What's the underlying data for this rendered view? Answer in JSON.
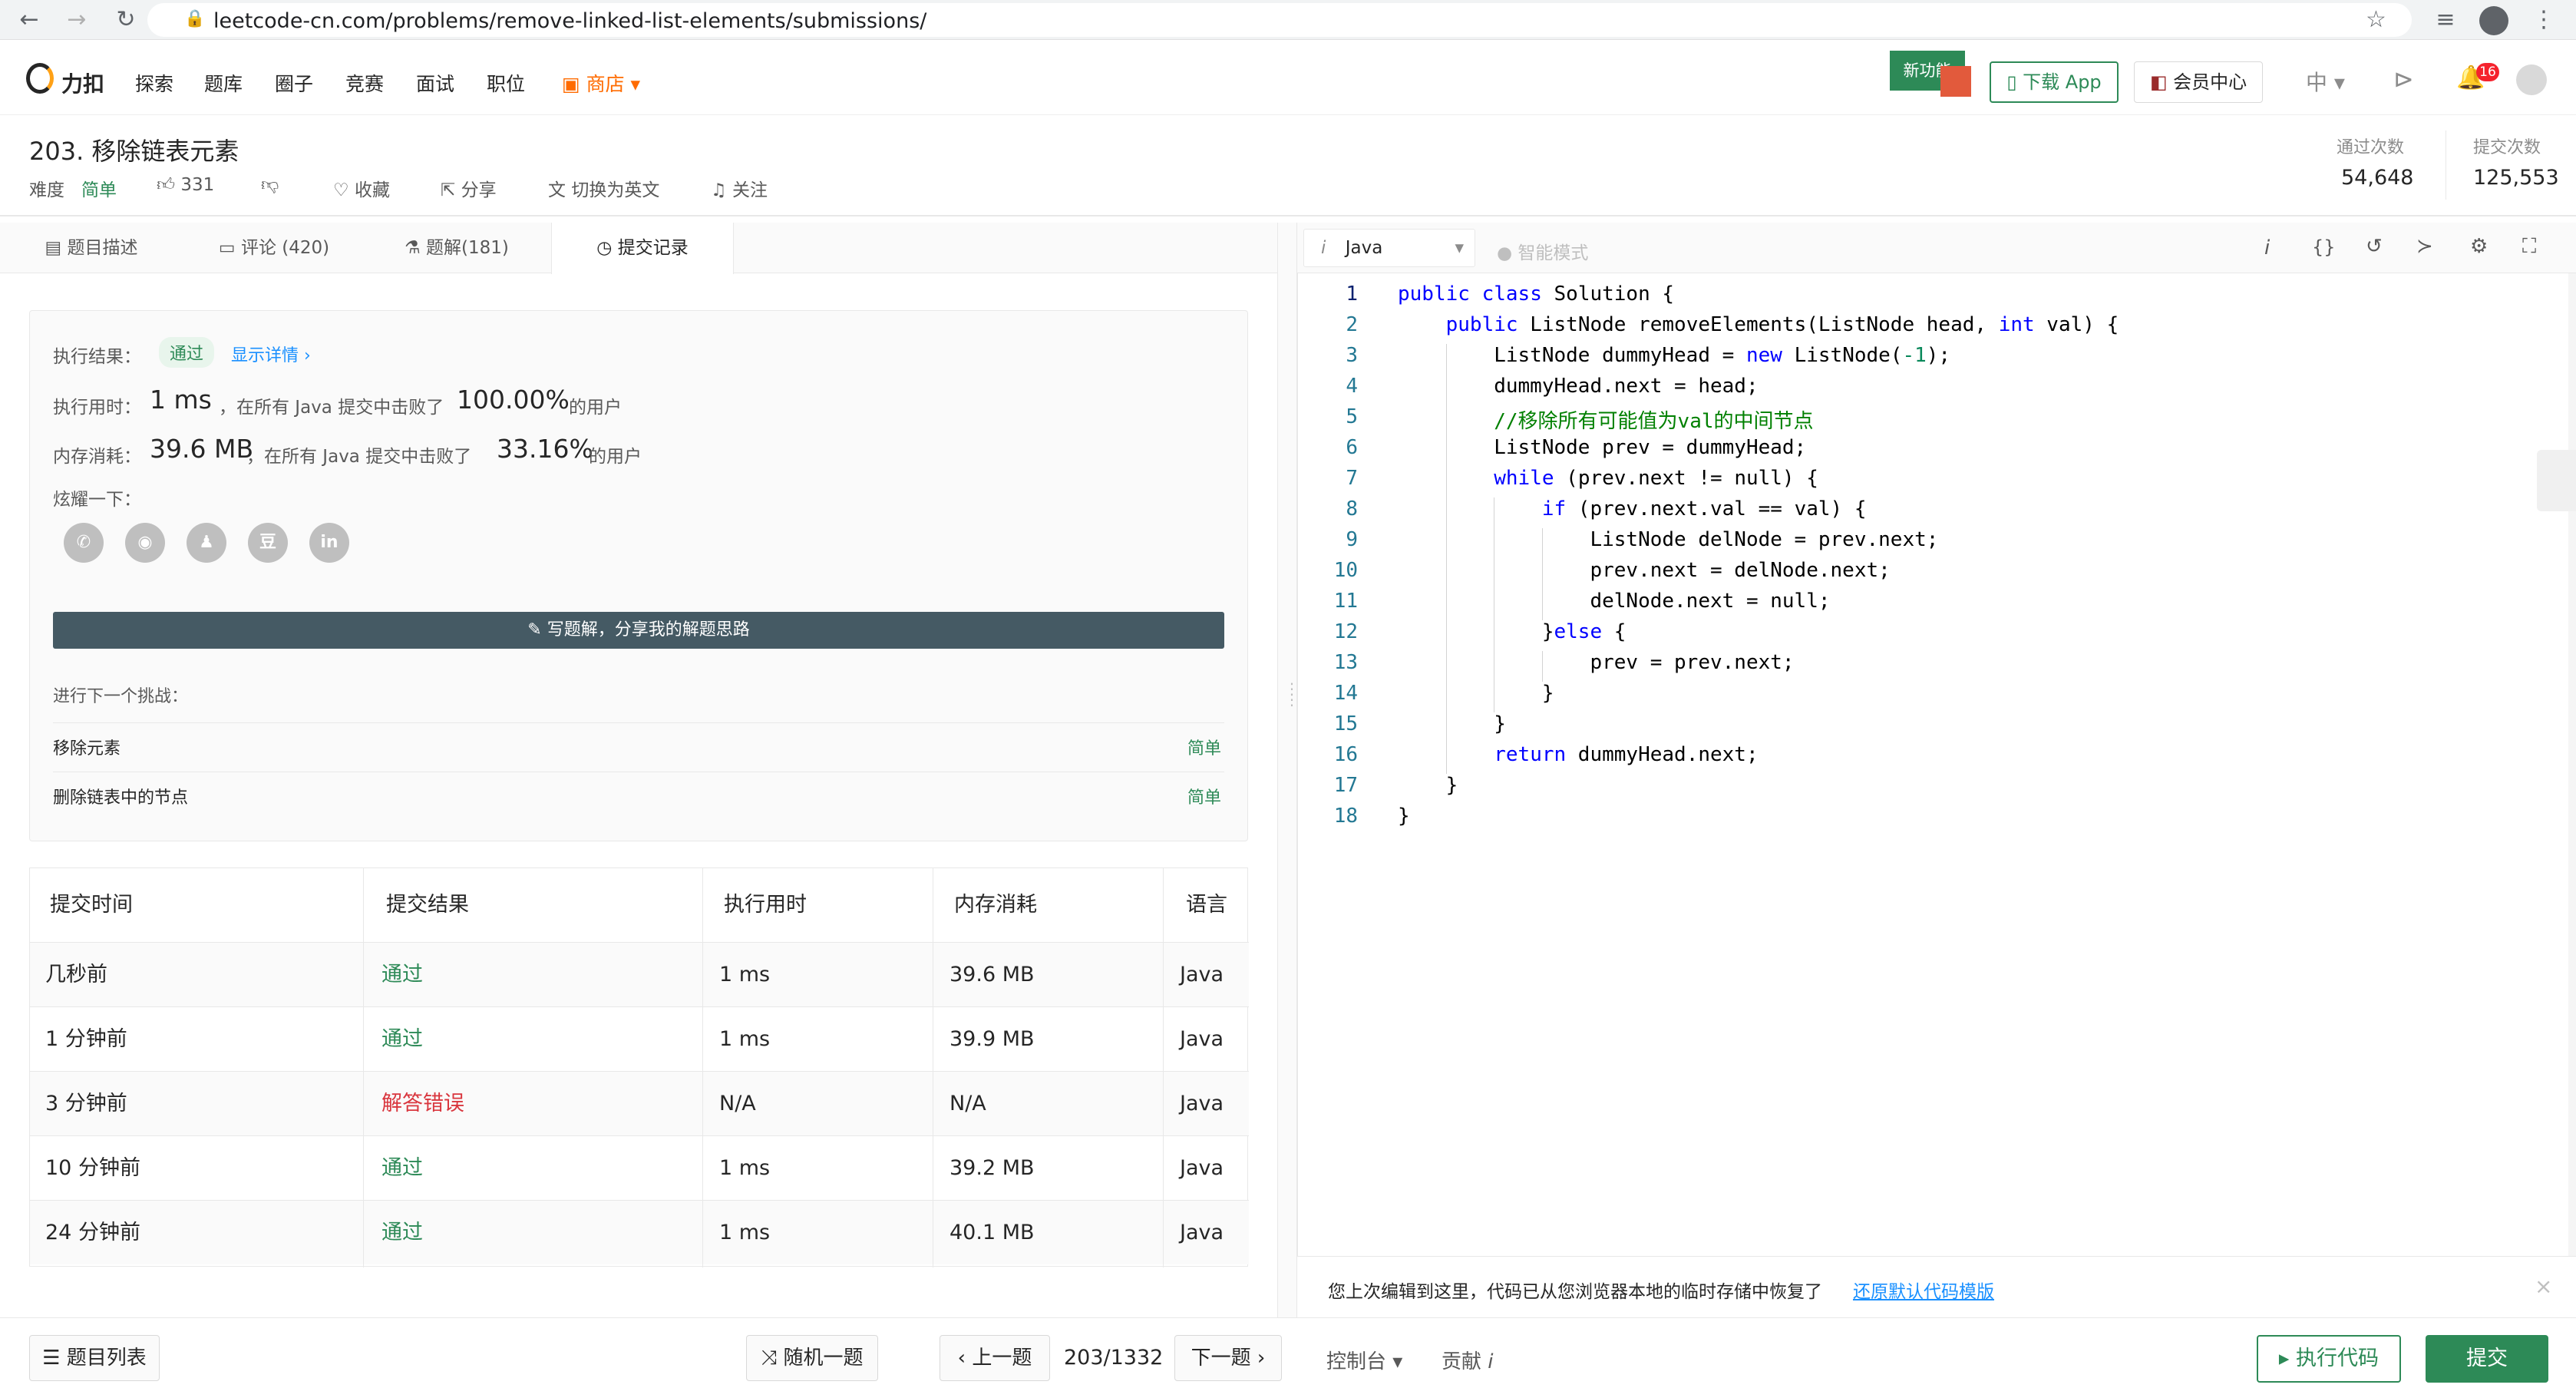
{
  "browser": {
    "url": "leetcode-cn.com/problems/remove-linked-list-elements/submissions/"
  },
  "nav": {
    "logo": "力扣",
    "links": [
      "探索",
      "题库",
      "圈子",
      "竞赛",
      "面试",
      "职位"
    ],
    "store": "商店",
    "new_feature_badge": "新功能",
    "download_app": "下载 App",
    "vip": "会员中心",
    "lang": "中",
    "notification_count": "16"
  },
  "problem": {
    "title": "203. 移除链表元素",
    "difficulty_label": "难度",
    "difficulty": "简单",
    "likes": "331",
    "favorite": "收藏",
    "share": "分享",
    "switch_lang": "切换为英文",
    "follow": "关注",
    "accepted_label": "通过次数",
    "accepted_count": "54,648",
    "submissions_label": "提交次数",
    "submissions_count": "125,553"
  },
  "tabs": [
    {
      "label": "题目描述"
    },
    {
      "label": "评论 (420)"
    },
    {
      "label": "题解(181)"
    },
    {
      "label": "提交记录"
    }
  ],
  "result": {
    "label": "执行结果：",
    "status": "通过",
    "details": "显示详情 ›",
    "runtime_label": "执行用时：",
    "runtime_value": "1 ms",
    "runtime_mid": "，在所有 Java 提交中击败了",
    "runtime_percent": "100.00%",
    "runtime_suffix": "的用户",
    "memory_label": "内存消耗：",
    "memory_value": "39.6 MB",
    "memory_mid": "，在所有 Java 提交中击败了",
    "memory_percent": "33.16%",
    "memory_suffix": "的用户",
    "share_label": "炫耀一下：",
    "share_icons": [
      "wechat-icon",
      "weibo-icon",
      "qq-icon",
      "douban-icon",
      "linkedin-icon"
    ],
    "write_solution": "写题解，分享我的解题思路",
    "next_label": "进行下一个挑战：",
    "next": [
      {
        "title": "移除元素",
        "difficulty": "简单"
      },
      {
        "title": "删除链表中的节点",
        "difficulty": "简单"
      }
    ]
  },
  "table": {
    "headers": [
      "提交时间",
      "提交结果",
      "执行用时",
      "内存消耗",
      "语言"
    ],
    "rows": [
      {
        "time": "几秒前",
        "result": "通过",
        "runtime": "1 ms",
        "memory": "39.6 MB",
        "lang": "Java"
      },
      {
        "time": "1 分钟前",
        "result": "通过",
        "runtime": "1 ms",
        "memory": "39.9 MB",
        "lang": "Java"
      },
      {
        "time": "3 分钟前",
        "result": "解答错误",
        "runtime": "N/A",
        "memory": "N/A",
        "lang": "Java"
      },
      {
        "time": "10 分钟前",
        "result": "通过",
        "runtime": "1 ms",
        "memory": "39.2 MB",
        "lang": "Java"
      },
      {
        "time": "24 分钟前",
        "result": "通过",
        "runtime": "1 ms",
        "memory": "40.1 MB",
        "lang": "Java"
      }
    ]
  },
  "editor": {
    "language": "Java",
    "smart_mode": "智能模式",
    "restore_notice": "您上次编辑到这里，代码已从您浏览器本地的临时存储中恢复了",
    "restore_link": "还原默认代码模版",
    "code_lines": [
      "public class Solution {",
      "    public ListNode removeElements(ListNode head, int val) {",
      "        ListNode dummyHead = new ListNode(-1);",
      "        dummyHead.next = head;",
      "        //移除所有可能值为val的中间节点",
      "        ListNode prev = dummyHead;",
      "        while (prev.next != null) {",
      "            if (prev.next.val == val) {",
      "                ListNode delNode = prev.next;",
      "                prev.next = delNode.next;",
      "                delNode.next = null;",
      "            }else {",
      "                prev = prev.next;",
      "            }",
      "        }",
      "        return dummyHead.next;",
      "    }",
      "}"
    ]
  },
  "bottom": {
    "problem_list": "题目列表",
    "random": "随机一题",
    "prev": "‹ 上一题",
    "page": "203/1332",
    "next": "下一题 ›",
    "console": "控制台",
    "contribute": "贡献",
    "run": "▸ 执行代码",
    "submit": "提交"
  },
  "colors": {
    "green": "#2db55d",
    "teal_link": "#1a90ff",
    "pass": "#2d8a57",
    "error": "#d9363e",
    "submit_bg": "#2d8a57"
  }
}
